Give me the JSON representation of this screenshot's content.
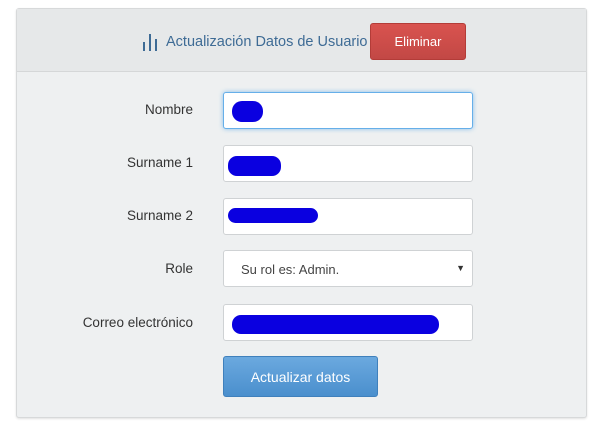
{
  "header": {
    "title": "Actualización Datos de Usuario",
    "delete_label": "Eliminar",
    "icon": "bar-chart-icon"
  },
  "form": {
    "fields": [
      {
        "label": "Nombre",
        "value": "",
        "redacted": true
      },
      {
        "label": "Surname 1",
        "value": "",
        "redacted": true
      },
      {
        "label": "Surname 2",
        "value": "",
        "redacted": true
      },
      {
        "label": "Role",
        "selected": "Su rol es: Admin."
      },
      {
        "label": "Correo electrónico",
        "value": "",
        "redacted": true
      }
    ],
    "submit_label": "Actualizar datos"
  },
  "colors": {
    "title": "#3e6b95",
    "danger": "#d9534f",
    "primary": "#5b9bd5",
    "redaction": "#0a00e0"
  }
}
